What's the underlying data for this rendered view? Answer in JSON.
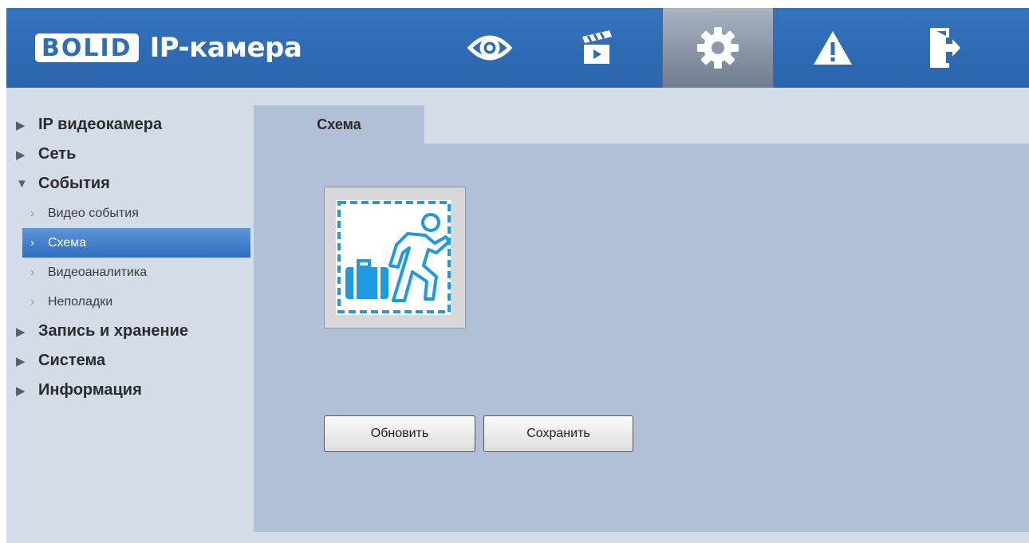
{
  "header": {
    "logo_badge": "BOLID",
    "logo_text": "IP-камера",
    "nav": [
      {
        "name": "live-view",
        "icon": "eye-icon"
      },
      {
        "name": "playback",
        "icon": "clapperboard-icon"
      },
      {
        "name": "settings",
        "icon": "gear-icon",
        "active": true
      },
      {
        "name": "alarm",
        "icon": "warning-icon"
      },
      {
        "name": "logout",
        "icon": "exit-door-icon"
      }
    ]
  },
  "sidebar": {
    "items": [
      {
        "label": "IP видеокамера",
        "expanded": false
      },
      {
        "label": "Сеть",
        "expanded": false
      },
      {
        "label": "События",
        "expanded": true,
        "children": [
          {
            "label": "Видео события"
          },
          {
            "label": "Схема",
            "active": true
          },
          {
            "label": "Видеоаналитика"
          },
          {
            "label": "Неполадки"
          }
        ]
      },
      {
        "label": "Запись и хранение",
        "expanded": false
      },
      {
        "label": "Система",
        "expanded": false
      },
      {
        "label": "Информация",
        "expanded": false
      }
    ]
  },
  "main": {
    "tab_label": "Схема",
    "scheme_icon": "abandoned-object-icon",
    "buttons": {
      "refresh_label": "Обновить",
      "save_label": "Сохранить"
    }
  },
  "colors": {
    "header": "#2f6db5",
    "sidebar_bg": "#d4dce7",
    "content_bg": "#b1c0d6",
    "active_item": "#3a77c8",
    "icon_blue": "#1e9be0"
  }
}
